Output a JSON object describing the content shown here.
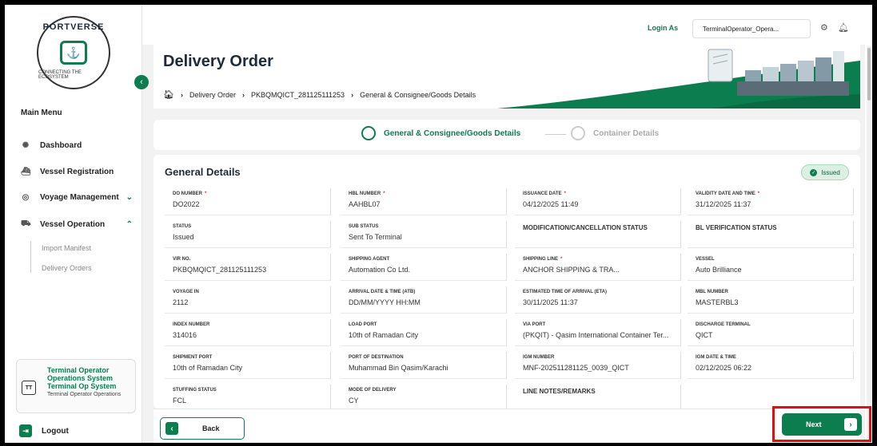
{
  "brand": {
    "top": "PORTVERSE",
    "bottom": "CONNECTING THE ECOSYSTEM"
  },
  "sidebar": {
    "menu_title": "Main Menu",
    "items": [
      {
        "label": "Dashboard",
        "icon": "dashboard-icon"
      },
      {
        "label": "Vessel Registration",
        "icon": "ship-icon"
      },
      {
        "label": "Voyage Management",
        "icon": "route-icon"
      },
      {
        "label": "Vessel Operation",
        "icon": "vessel-icon"
      }
    ],
    "sub_items": [
      "Import Manifest",
      "Delivery Orders"
    ],
    "user": {
      "initials": "TT",
      "name": "Terminal Operator Operations System Terminal Op System",
      "role": "Terminal Operator Operations"
    },
    "logout": "Logout"
  },
  "topbar": {
    "login_label": "Login As",
    "login_value": "TerminalOperator_Opera..."
  },
  "header": {
    "title": "Delivery Order",
    "breadcrumb": [
      "Delivery Order",
      "PKBQMQICT_281125111253",
      "General & Consignee/Goods Details"
    ]
  },
  "stepper": {
    "step1": "General & Consignee/Goods Details",
    "step2": "Container Details"
  },
  "details": {
    "title": "General Details",
    "status_badge": "Issued",
    "fields": [
      {
        "label": "DO Number",
        "value": "DO2022",
        "req": "*"
      },
      {
        "label": "HBL Number",
        "value": "AAHBL07",
        "req": "*"
      },
      {
        "label": "Issuance Date",
        "value": "04/12/2025 11:49",
        "req": "*"
      },
      {
        "label": "Validity Date and Time",
        "value": "31/12/2025 11:37",
        "req": "*"
      },
      {
        "label": "Status",
        "value": "Issued"
      },
      {
        "label": "Sub Status",
        "value": "Sent To Terminal"
      },
      {
        "label": "Modification/Cancellation Status",
        "value": ""
      },
      {
        "label": "BL Verification Status",
        "value": ""
      },
      {
        "label": "VIR No.",
        "value": "PKBQMQICT_281125111253"
      },
      {
        "label": "Shipping Agent",
        "value": "Automation Co Ltd."
      },
      {
        "label": "Shipping Line",
        "value": "ANCHOR SHIPPING & TRA...",
        "req": "*"
      },
      {
        "label": "Vessel",
        "value": "Auto Brilliance"
      },
      {
        "label": "Voyage In",
        "value": "2112"
      },
      {
        "label": "Arrival Date & Time (ATB)",
        "value": "DD/MM/YYYY HH:MM"
      },
      {
        "label": "Estimated Time of Arrival (ETA)",
        "value": "30/11/2025 11:37"
      },
      {
        "label": "MBL Number",
        "value": "MASTERBL3"
      },
      {
        "label": "Index Number",
        "value": "314016"
      },
      {
        "label": "Load Port",
        "value": "10th of Ramadan City"
      },
      {
        "label": "Via Port",
        "value": "(PKQIT) - Qasim International Container Ter..."
      },
      {
        "label": "Discharge Terminal",
        "value": "QICT"
      },
      {
        "label": "Shipment Port",
        "value": "10th of Ramadan City"
      },
      {
        "label": "Port of Destination",
        "value": "Muhammad Bin Qasim/Karachi"
      },
      {
        "label": "IGM Number",
        "value": "MNF-202511281125_0039_QICT"
      },
      {
        "label": "IGM Date & Time",
        "value": "02/12/2025 06:22"
      },
      {
        "label": "Stuffing Status",
        "value": "FCL"
      },
      {
        "label": "Mode of Delivery",
        "value": "CY"
      },
      {
        "label": "Line Notes/Remarks",
        "value": ""
      }
    ]
  },
  "footer": {
    "back": "Back",
    "next": "Next"
  },
  "colors": {
    "accent": "#0b7d4f",
    "highlight": "#e01010"
  }
}
